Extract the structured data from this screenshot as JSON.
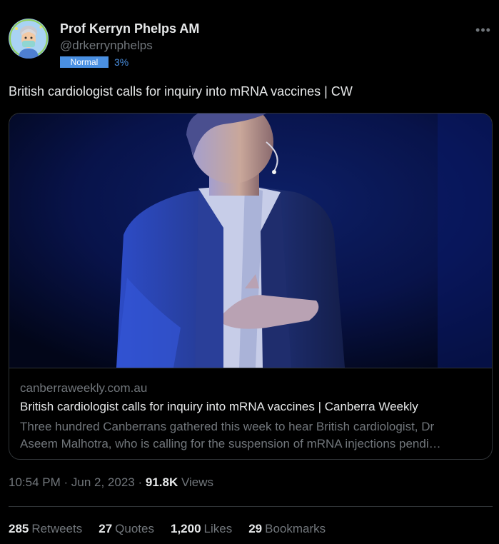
{
  "author": {
    "name": "Prof Kerryn Phelps AM",
    "handle": "@drkerrynphelps",
    "badge_label": "Normal",
    "badge_value": "3%"
  },
  "tweet": {
    "text": "British cardiologist calls for inquiry into mRNA vaccines | CW"
  },
  "link_card": {
    "domain": "canberraweekly.com.au",
    "title": "British cardiologist calls for inquiry into mRNA vaccines | Canberra Weekly",
    "description_line1": "Three hundred Canberrans gathered this week to hear British cardiologist, Dr",
    "description_line2": "Aseem Malhotra, who is calling for the suspension of mRNA injections pendi…"
  },
  "meta": {
    "time": "10:54 PM",
    "date": "Jun 2, 2023",
    "views_count": "91.8K",
    "views_label": "Views"
  },
  "stats": [
    {
      "count": "285",
      "label": "Retweets"
    },
    {
      "count": "27",
      "label": "Quotes"
    },
    {
      "count": "1,200",
      "label": "Likes"
    },
    {
      "count": "29",
      "label": "Bookmarks"
    }
  ],
  "colors": {
    "background": "#000000",
    "text": "#e7e9ea",
    "muted": "#71767b",
    "border": "#2f3336",
    "badge": "#4a90e2"
  },
  "icons": {
    "more": "more-options-icon",
    "avatar": "memoji-avatar"
  }
}
